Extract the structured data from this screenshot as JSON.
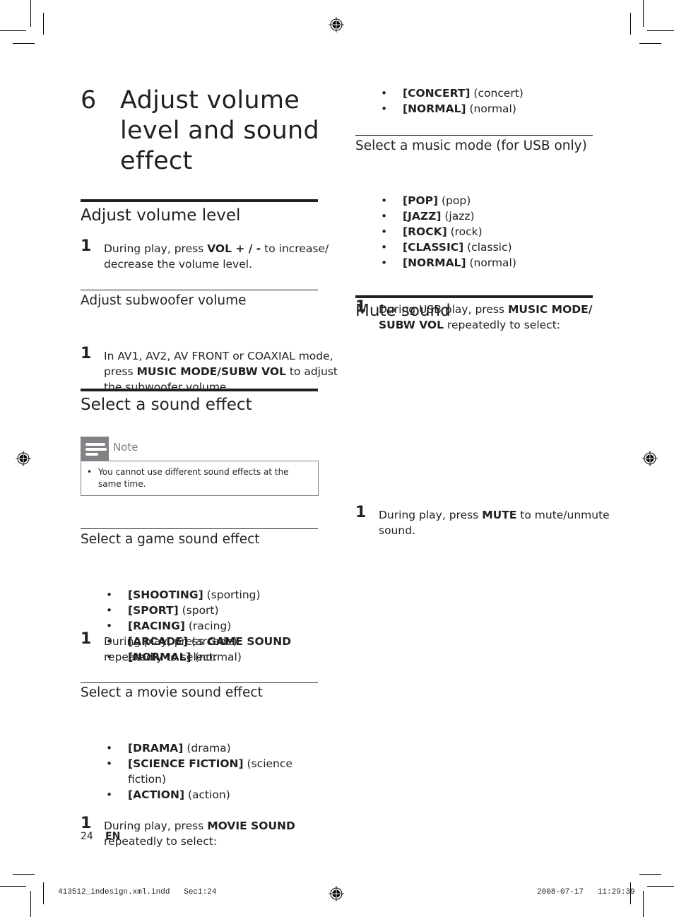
{
  "chapter": {
    "number": "6",
    "title_lines": [
      "Adjust volume",
      "level and sound",
      "effect"
    ]
  },
  "left_column": {
    "volume": {
      "heading": "Adjust volume level",
      "step_num": "1",
      "step_pre": "During play, press ",
      "step_bold": "VOL + / -",
      "step_post": " to increase/ decrease the volume level."
    },
    "subwoofer": {
      "heading": "Adjust subwoofer volume",
      "step_num": "1",
      "step_pre": "In AV1, AV2, AV FRONT or COAXIAL mode, press ",
      "step_bold": "MUSIC MODE/SUBW VOL",
      "step_post": " to adjust the subwoofer volume."
    },
    "sound_effect": {
      "heading": "Select a sound effect",
      "note_label": "Note",
      "note_bullet": "•",
      "note_text": "You cannot use different sound effects at the same time."
    },
    "game": {
      "heading": "Select a game sound effect",
      "step_num": "1",
      "step_pre": "During play, press ",
      "step_bold": "GAME SOUND",
      "step_post": " repeatedly to select:",
      "options": [
        {
          "key": "[SHOOTING]",
          "desc": " (sporting)"
        },
        {
          "key": "[SPORT]",
          "desc": " (sport)"
        },
        {
          "key": "[RACING]",
          "desc": " (racing)"
        },
        {
          "key": "[ARCADE]",
          "desc": " (arcade)"
        },
        {
          "key": "[NORMAL]",
          "desc": " (normal)"
        }
      ]
    },
    "movie": {
      "heading": "Select a movie sound effect",
      "step_num": "1",
      "step_pre": "During play, press ",
      "step_bold": "MOVIE SOUND",
      "step_post": " repeatedly to select:",
      "options": [
        {
          "key": "[DRAMA]",
          "desc": " (drama)"
        },
        {
          "key": "[SCIENCE FICTION]",
          "desc": " (science fiction)"
        },
        {
          "key": "[ACTION]",
          "desc": " (action)"
        }
      ]
    }
  },
  "right_column": {
    "continued_options": [
      {
        "key": "[CONCERT]",
        "desc": " (concert)"
      },
      {
        "key": "[NORMAL]",
        "desc": " (normal)"
      }
    ],
    "music_mode": {
      "heading": "Select a music mode (for USB only)",
      "step_num": "1",
      "step_pre": "During USB play, press ",
      "step_bold": "MUSIC MODE/ SUBW VOL",
      "step_post": " repeatedly to select:",
      "options": [
        {
          "key": "[POP]",
          "desc": " (pop)"
        },
        {
          "key": "[JAZZ]",
          "desc": " (jazz)"
        },
        {
          "key": "[ROCK]",
          "desc": " (rock)"
        },
        {
          "key": "[CLASSIC]",
          "desc": " (classic)"
        },
        {
          "key": "[NORMAL]",
          "desc": " (normal)"
        }
      ]
    },
    "mute": {
      "heading": "Mute sound",
      "step_num": "1",
      "step_pre": "During play, press ",
      "step_bold": "MUTE",
      "step_post": " to mute/unmute sound."
    }
  },
  "footer": {
    "page_number": "24",
    "language": "EN",
    "slug_file": "413512_indesign.xml.indd   Sec1:24",
    "slug_date": "2008-07-17   11:29:39"
  },
  "bullet_glyph": "•"
}
